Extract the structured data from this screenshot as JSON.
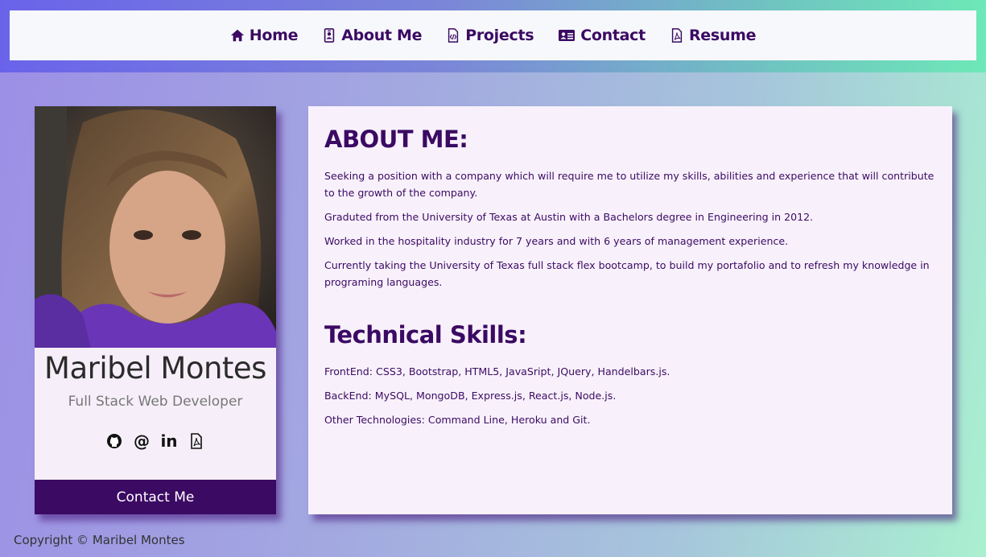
{
  "nav": {
    "items": [
      {
        "label": "Home",
        "icon": "home-icon"
      },
      {
        "label": "About Me",
        "icon": "id-badge-icon"
      },
      {
        "label": "Projects",
        "icon": "code-file-icon"
      },
      {
        "label": "Contact",
        "icon": "address-card-icon"
      },
      {
        "label": "Resume",
        "icon": "pdf-file-icon"
      }
    ]
  },
  "profile": {
    "name": "Maribel Montes",
    "role": "Full Stack Web Developer",
    "socials": [
      "github-icon",
      "at-icon",
      "linkedin-icon",
      "pdf-file-icon"
    ],
    "contact_label": "Contact Me"
  },
  "about": {
    "title": "ABOUT ME:",
    "paragraphs": [
      "Seeking a position with a company which will require me to utilize my skills, abilities and experience that will contribute to the growth of the company.",
      "Graduted from the University of Texas at Austin with a Bachelors degree in Engineering in 2012.",
      "Worked in the hospitality industry for 7 years and with 6 years of management experience.",
      "Currently taking the University of Texas full stack flex bootcamp, to build my portafolio and to refresh my knowledge in programing languages."
    ],
    "skills_title": "Technical Skills:",
    "skills": [
      "FrontEnd: CSS3, Bootstrap, HTML5, JavaSript, JQuery, Handelbars.js.",
      "BackEnd: MySQL, MongoDB, Express.js, React.js, Node.js.",
      "Other Technologies: Command Line, Heroku and Git."
    ]
  },
  "footer": {
    "text": "Copyright © Maribel Montes"
  },
  "colors": {
    "accent": "#3b0a63",
    "nav_bg": "#f7f8fb",
    "card_bg": "#f6eff9"
  }
}
